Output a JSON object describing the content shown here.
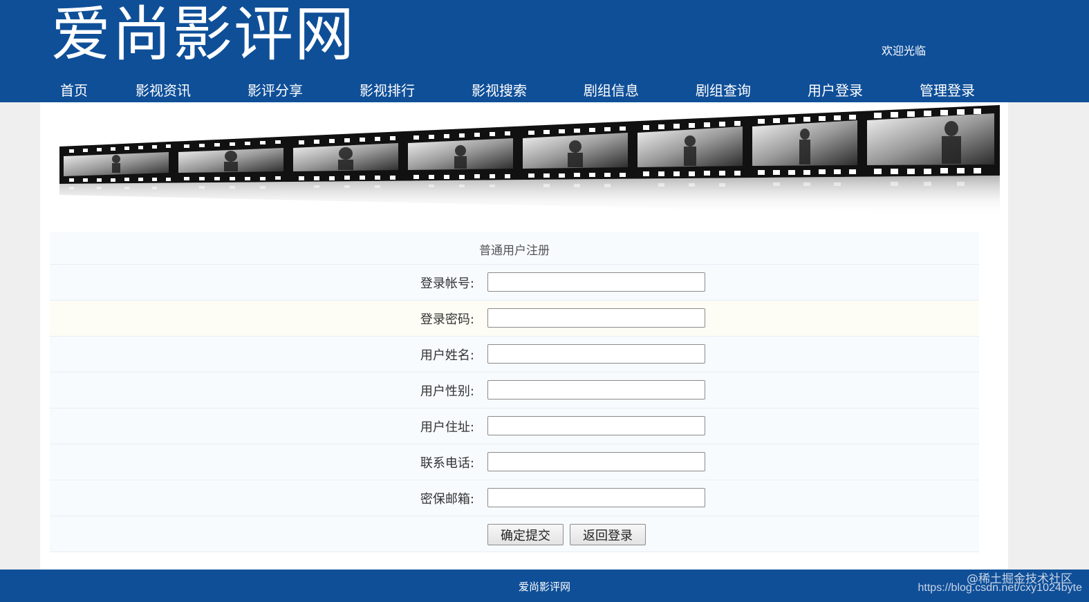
{
  "header": {
    "site_title": "爱尚影评网",
    "welcome": "欢迎光临"
  },
  "nav": {
    "items": [
      {
        "label": "首页"
      },
      {
        "label": "影视资讯"
      },
      {
        "label": "影评分享"
      },
      {
        "label": "影视排行"
      },
      {
        "label": "影视搜索"
      },
      {
        "label": "剧组信息"
      },
      {
        "label": "剧组查询"
      },
      {
        "label": "用户登录"
      },
      {
        "label": "管理登录"
      }
    ]
  },
  "form": {
    "title": "普通用户注册",
    "fields": [
      {
        "label": "登录帐号:",
        "value": ""
      },
      {
        "label": "登录密码:",
        "value": ""
      },
      {
        "label": "用户姓名:",
        "value": ""
      },
      {
        "label": "用户性别:",
        "value": ""
      },
      {
        "label": "用户住址:",
        "value": ""
      },
      {
        "label": "联系电话:",
        "value": ""
      },
      {
        "label": "密保邮箱:",
        "value": ""
      }
    ],
    "submit_label": "确定提交",
    "back_label": "返回登录"
  },
  "footer": {
    "text": "爱尚影评网"
  },
  "watermark": {
    "line1": "@稀土掘金技术社区",
    "line2": "https://blog.csdn.net/cxy1024byte"
  },
  "colors": {
    "header_bg": "#0f4f98",
    "page_bg": "#efefef",
    "row_bg": "#f7fbfe",
    "row_alt_bg": "#fdfdf5"
  },
  "icons": {
    "banner": "film-strip-banner"
  }
}
